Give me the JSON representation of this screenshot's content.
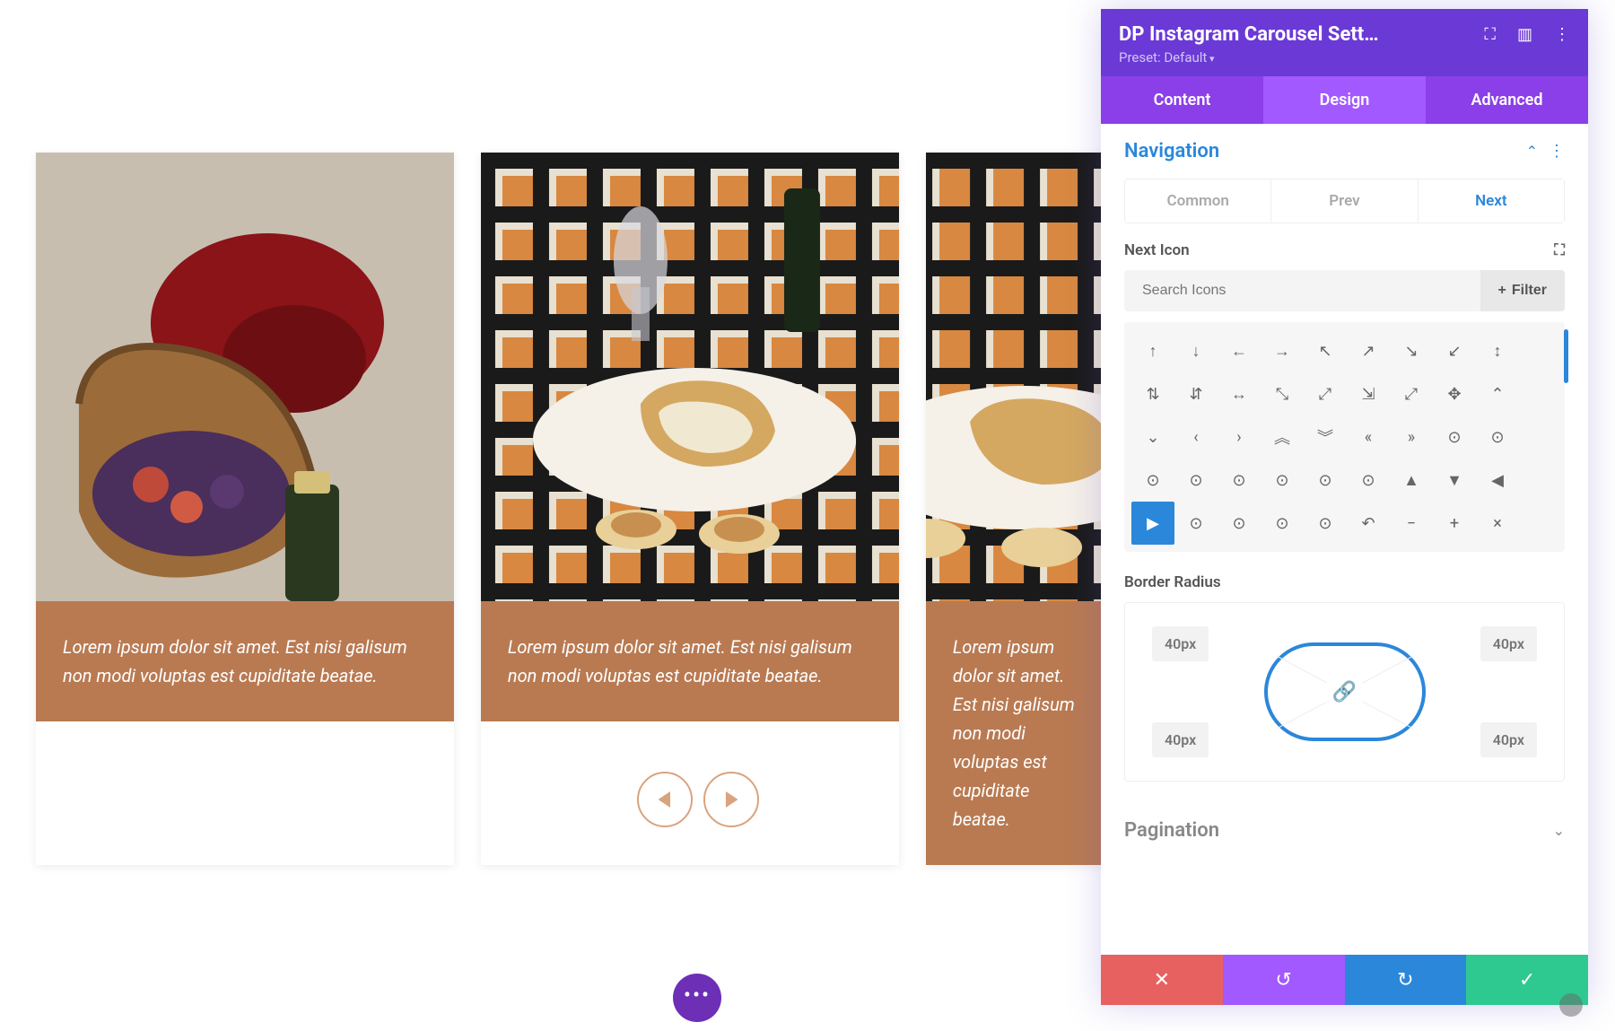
{
  "carousel": {
    "captions": [
      "Lorem ipsum dolor sit amet. Est nisi galisum non modi voluptas est cupiditate beatae.",
      "Lorem ipsum dolor sit amet. Est nisi galisum non modi voluptas est cupiditate beatae.",
      "Lorem ipsum dolor sit amet. Est nisi galisum non modi voluptas est cupiditate beatae."
    ]
  },
  "panel": {
    "title": "DP Instagram Carousel Sett…",
    "preset": "Preset: Default",
    "tabs": {
      "content": "Content",
      "design": "Design",
      "advanced": "Advanced"
    },
    "navigation": {
      "title": "Navigation",
      "subtabs": {
        "common": "Common",
        "prev": "Prev",
        "next": "Next"
      },
      "next_icon_label": "Next Icon",
      "search_placeholder": "Search Icons",
      "filter_label": "Filter",
      "icons": [
        [
          "↑",
          "↓",
          "←",
          "→",
          "↖",
          "↗",
          "↘",
          "↙",
          "↕"
        ],
        [
          "⇅",
          "⇵",
          "↔",
          "⤡",
          "⤢",
          "⇲",
          "⤢",
          "✥",
          "⌃"
        ],
        [
          "⌄",
          "‹",
          "›",
          "︽",
          "︾",
          "«",
          "»",
          "⊙",
          "⊙"
        ],
        [
          "⊙",
          "⊙",
          "⊙",
          "⊙",
          "⊙",
          "⊙",
          "▲",
          "▼",
          "◀"
        ],
        [
          "▶",
          "⊙",
          "⊙",
          "⊙",
          "⊙",
          "↶",
          "−",
          "+",
          "×"
        ]
      ],
      "selected_icon_row": 4,
      "selected_icon_col": 0,
      "border_radius_label": "Border Radius",
      "border_radius": {
        "tl": "40px",
        "tr": "40px",
        "bl": "40px",
        "br": "40px"
      }
    },
    "pagination": {
      "title": "Pagination"
    }
  }
}
